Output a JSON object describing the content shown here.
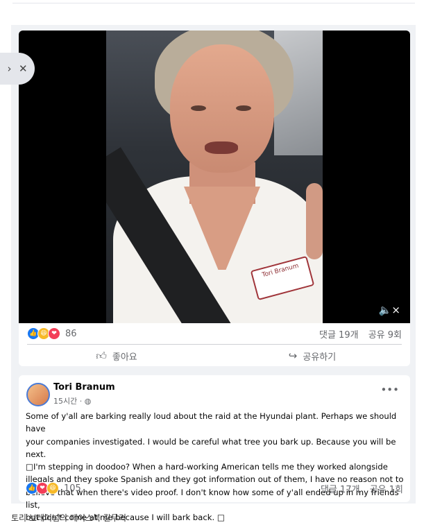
{
  "video_post": {
    "reaction_count": "86",
    "comments": "댓글 19개",
    "shares": "공유 9회",
    "like_label": "좋아요",
    "share_label": "공유하기",
    "badge_text": "Tori Branum"
  },
  "text_post": {
    "author": "Tori Branum",
    "time": "15시간 · ",
    "body": "Some of y'all are barking really loud about the raid at the Hyundai plant. Perhaps we should have\nyour companies investigated. I would be careful what tree you bark up. Because you will be next.\n□I'm stepping in doodoo?  When a  hard-working American tells me they worked alongside\nillegals and they spoke Spanish and they got information out of them, I have no reason not to\nbelieve that when there's video proof. I don't know how some of y'all ended up in  my friends list,\nbut don't come at me because I will bark back. □",
    "reaction_count": "105",
    "comments": "댓글 17개",
    "shares": "공유 1회"
  },
  "caption": "토리 브레이넘의 페이스북 갈무리",
  "icons": [
    "chevron-right-icon",
    "close-icon",
    "mute-icon",
    "like-icon",
    "share-icon",
    "globe-icon",
    "more-icon"
  ]
}
